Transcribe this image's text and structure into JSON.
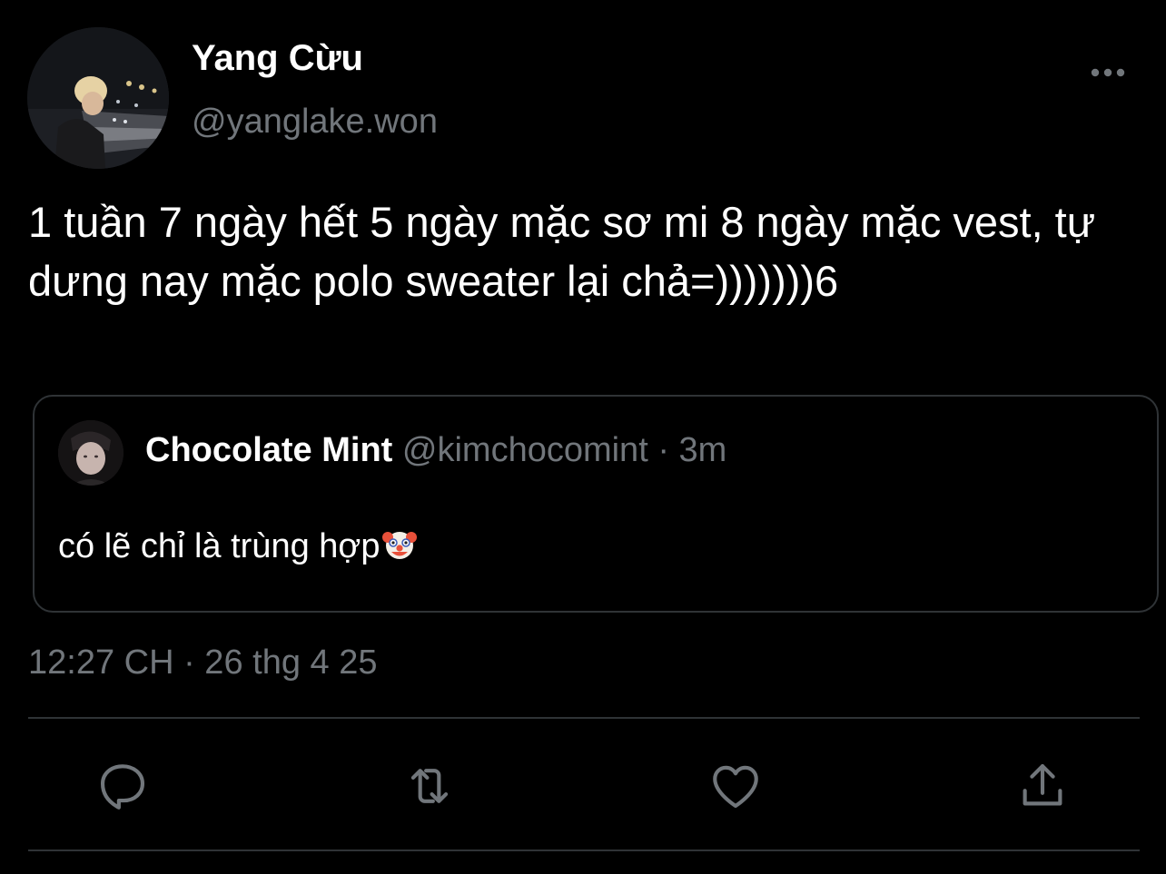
{
  "author": {
    "display_name": "Yang Cừu",
    "handle": "@yanglake.won",
    "avatar": "avatar-photo"
  },
  "menu_icon": "more-horizontal-icon",
  "tweet": {
    "text": "1 tuần 7 ngày hết 5 ngày mặc sơ mi 8 ngày mặc vest, tự dưng nay mặc polo sweater lại chả=)))))))6"
  },
  "quoted_tweet": {
    "display_name": "Chocolate Mint",
    "handle": "@kimchocomint",
    "separator": "·",
    "time": "3m",
    "text": "có lẽ chỉ là trùng hợp",
    "emoji": "clown-face-icon"
  },
  "timestamp": "12:27 CH · 26 thg 4 25",
  "actions": [
    {
      "name": "reply",
      "icon": "reply-icon"
    },
    {
      "name": "retweet",
      "icon": "retweet-icon"
    },
    {
      "name": "like",
      "icon": "heart-icon"
    },
    {
      "name": "share",
      "icon": "share-icon"
    }
  ],
  "colors": {
    "background": "#000000",
    "primary_text": "#ffffff",
    "secondary_text": "#71767b",
    "border": "#2f3336",
    "icon": "#71767b"
  }
}
